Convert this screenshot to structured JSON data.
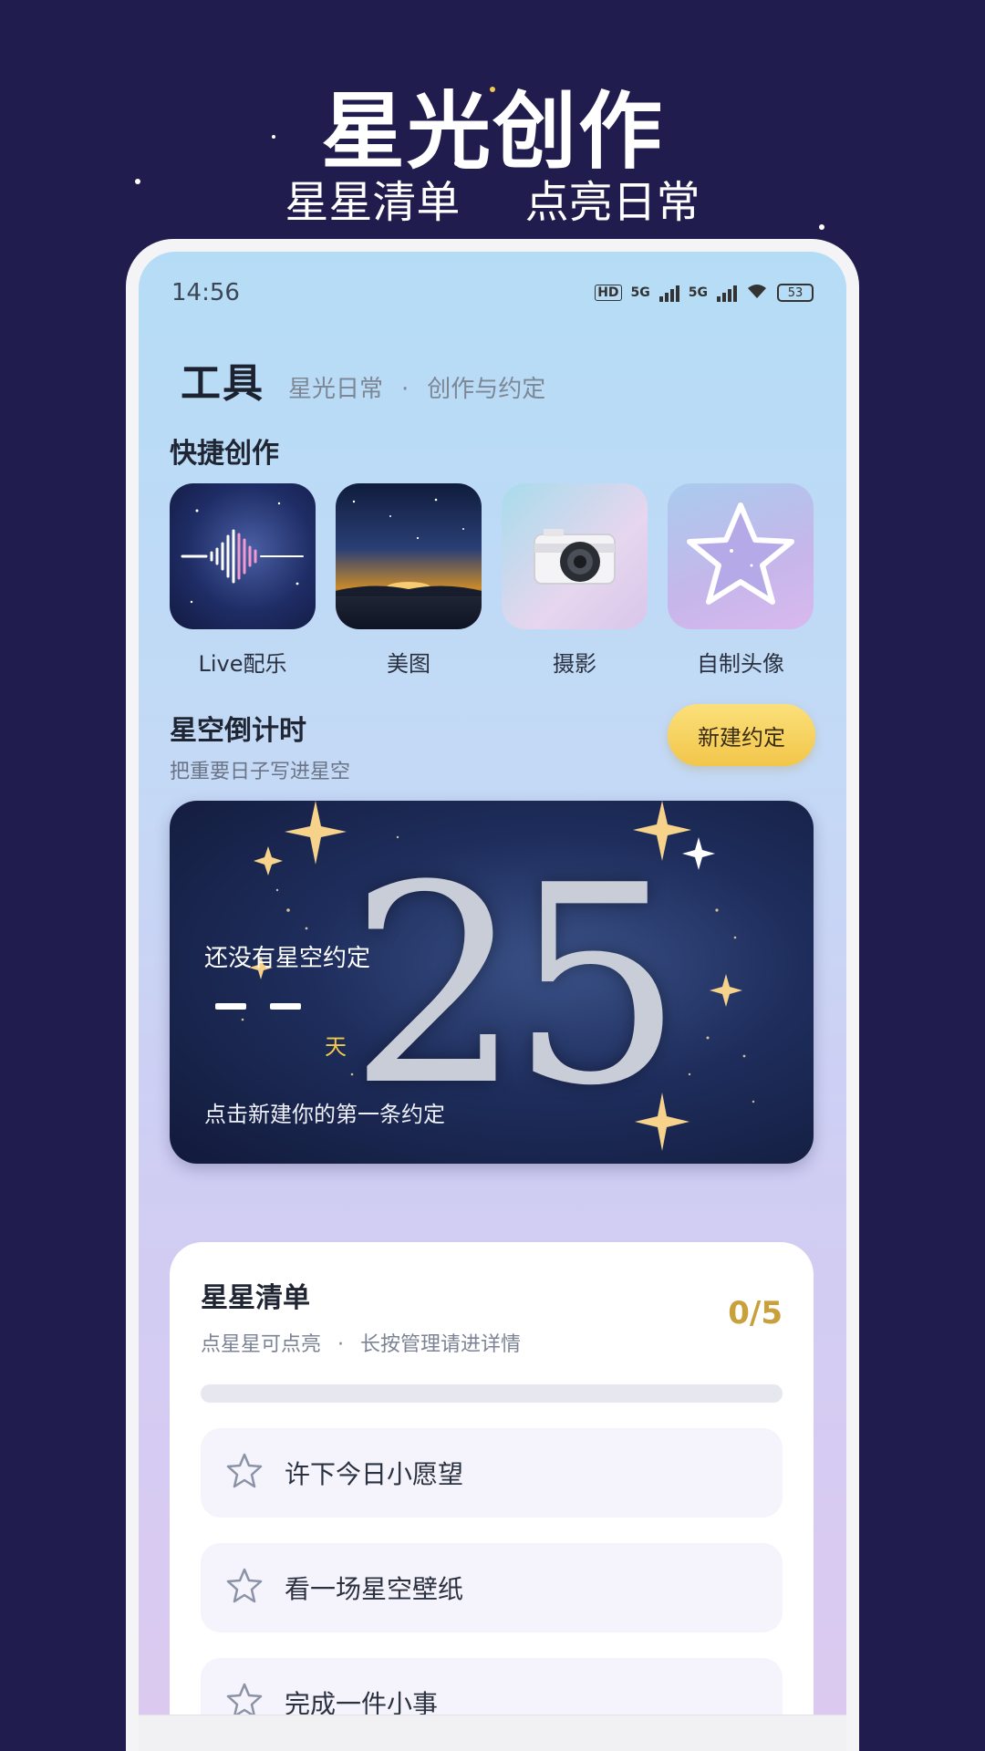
{
  "promo": {
    "title": "星光创作",
    "subtitle_left": "星星清单",
    "subtitle_right": "点亮日常"
  },
  "status_bar": {
    "time": "14:56",
    "network_1": "5G",
    "network_2": "5G",
    "hd_label": "HD",
    "battery": "53"
  },
  "header": {
    "title": "工具",
    "sub_left": "星光日常",
    "separator": "·",
    "sub_right": "创作与约定"
  },
  "quick_create": {
    "label": "快捷创作",
    "items": [
      {
        "label": "Live配乐",
        "icon": "soundwave-icon"
      },
      {
        "label": "美图",
        "icon": "starry-landscape-icon"
      },
      {
        "label": "摄影",
        "icon": "camera-icon"
      },
      {
        "label": "自制头像",
        "icon": "star-icon"
      }
    ]
  },
  "countdown": {
    "title": "星空倒计时",
    "subtitle": "把重要日子写进星空",
    "new_button": "新建约定",
    "card_number": "25",
    "card_title": "还没有星空约定",
    "card_unit": "天",
    "card_hint": "点击新建你的第一条约定"
  },
  "star_list": {
    "title": "星星清单",
    "sub_left": "点星星可点亮",
    "separator": "·",
    "sub_right": "长按管理请进详情",
    "count": "0/5",
    "progress": 0,
    "tasks": [
      {
        "label": "许下今日小愿望"
      },
      {
        "label": "看一场星空壁纸"
      },
      {
        "label": "完成一件小事"
      }
    ]
  },
  "colors": {
    "background": "#201c4d",
    "accent_gold": "#f2c64a",
    "count_gold": "#c8a03c"
  }
}
